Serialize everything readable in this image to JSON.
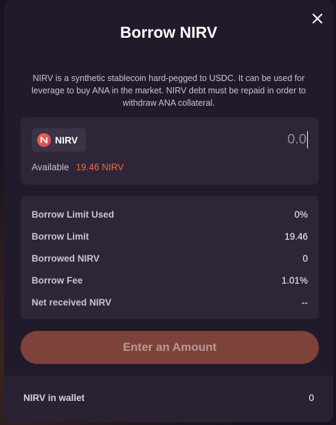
{
  "modal": {
    "title": "Borrow NIRV",
    "description": "NIRV is a synthetic stablecoin hard-pegged to USDC. It can be used for leverage to buy ANA in the market. NIRV debt must be repaid in order to withdraw ANA collateral.",
    "close_icon": "close-icon"
  },
  "input": {
    "token_label": "NIRV",
    "token_icon": "nirv-logo-icon",
    "amount_placeholder": "0.0",
    "available_label": "Available",
    "available_value": "19.46 NIRV"
  },
  "stats": [
    {
      "label": "Borrow Limit Used",
      "value": "0%"
    },
    {
      "label": "Borrow Limit",
      "value": "19.46"
    },
    {
      "label": "Borrowed NIRV",
      "value": "0"
    },
    {
      "label": "Borrow Fee",
      "value": "1.01%"
    },
    {
      "label": "Net received NIRV",
      "value": "--"
    }
  ],
  "cta": {
    "label": "Enter an Amount"
  },
  "wallet": {
    "label": "NIRV in wallet",
    "value": "0"
  },
  "colors": {
    "accent": "#ec6a44",
    "modal_bg": "#211a2b",
    "card_bg": "#2e2638",
    "cta_bg": "#7d4239"
  }
}
